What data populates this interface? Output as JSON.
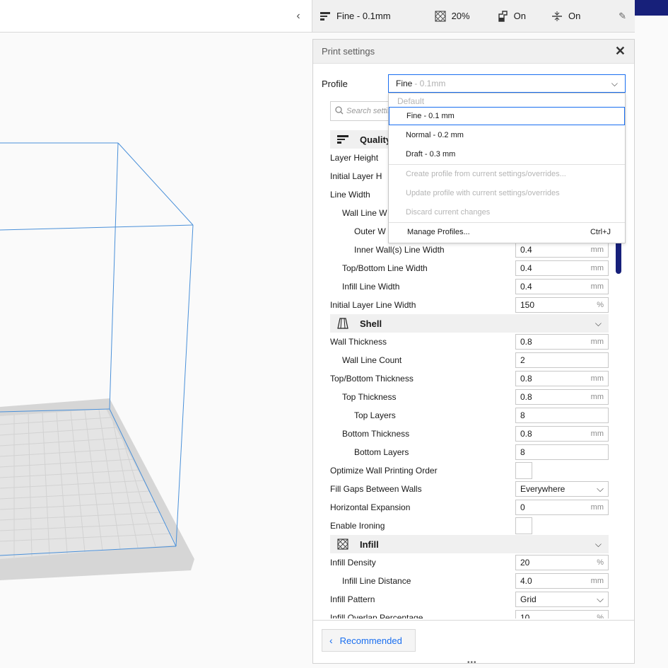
{
  "viewport": {
    "collapse_icon": "chevron-left-icon"
  },
  "summary_bar": {
    "profile": {
      "icon": "layer-height-icon",
      "label": "Fine - 0.1mm"
    },
    "infill": {
      "icon": "infill-icon",
      "label": "20%"
    },
    "support": {
      "icon": "support-icon",
      "label": "On"
    },
    "adhesion": {
      "icon": "adhesion-icon",
      "label": "On"
    },
    "edit_icon": "pencil-icon"
  },
  "panel": {
    "title": "Print settings",
    "close_icon": "close-icon",
    "profile_label": "Profile",
    "profile_value": "Fine",
    "profile_value_hint": "- 0.1mm",
    "search_placeholder": "Search settings"
  },
  "dropdown": {
    "header": "Default",
    "items": [
      "Fine - 0.1 mm",
      "Normal - 0.2 mm",
      "Draft - 0.3 mm"
    ],
    "actions": [
      "Create profile from current settings/overrides...",
      "Update profile with current settings/overrides",
      "Discard current changes"
    ],
    "manage": {
      "label": "Manage Profiles...",
      "shortcut": "Ctrl+J"
    }
  },
  "categories": {
    "quality": {
      "name": "Quality",
      "icon": "quality-icon"
    },
    "shell": {
      "name": "Shell",
      "icon": "shell-icon"
    },
    "infill": {
      "name": "Infill",
      "icon": "infill-icon"
    }
  },
  "settings": {
    "layer_height": {
      "label": "Layer Height"
    },
    "initial_layer_height": {
      "label": "Initial Layer H"
    },
    "line_width": {
      "label": "Line Width"
    },
    "wall_line_width": {
      "label": "Wall Line W"
    },
    "outer_wall_line_width": {
      "label": "Outer W"
    },
    "inner_wall_line_width": {
      "label": "Inner Wall(s) Line Width",
      "value": "0.4",
      "unit": "mm"
    },
    "top_bottom_line_width": {
      "label": "Top/Bottom Line Width",
      "value": "0.4",
      "unit": "mm"
    },
    "infill_line_width": {
      "label": "Infill Line Width",
      "value": "0.4",
      "unit": "mm"
    },
    "initial_layer_line_width": {
      "label": "Initial Layer Line Width",
      "value": "150",
      "unit": "%"
    },
    "wall_thickness": {
      "label": "Wall Thickness",
      "value": "0.8",
      "unit": "mm"
    },
    "wall_line_count": {
      "label": "Wall Line Count",
      "value": "2"
    },
    "top_bottom_thickness": {
      "label": "Top/Bottom Thickness",
      "value": "0.8",
      "unit": "mm"
    },
    "top_thickness": {
      "label": "Top Thickness",
      "value": "0.8",
      "unit": "mm"
    },
    "top_layers": {
      "label": "Top Layers",
      "value": "8"
    },
    "bottom_thickness": {
      "label": "Bottom Thickness",
      "value": "0.8",
      "unit": "mm"
    },
    "bottom_layers": {
      "label": "Bottom Layers",
      "value": "8"
    },
    "optimize_wall_order": {
      "label": "Optimize Wall Printing Order"
    },
    "fill_gaps": {
      "label": "Fill Gaps Between Walls",
      "value": "Everywhere"
    },
    "horizontal_expansion": {
      "label": "Horizontal Expansion",
      "value": "0",
      "unit": "mm"
    },
    "enable_ironing": {
      "label": "Enable Ironing"
    },
    "infill_density": {
      "label": "Infill Density",
      "value": "20",
      "unit": "%"
    },
    "infill_line_distance": {
      "label": "Infill Line Distance",
      "value": "4.0",
      "unit": "mm"
    },
    "infill_pattern": {
      "label": "Infill Pattern",
      "value": "Grid"
    },
    "infill_overlap": {
      "label": "Infill Overlap Percentage",
      "value": "10",
      "unit": "%"
    }
  },
  "footer": {
    "recommended_label": "Recommended",
    "icon": "chevron-left-icon"
  },
  "colors": {
    "accent": "#196ef0",
    "brand": "#17207a",
    "volume_lines": "#4a90d9"
  }
}
